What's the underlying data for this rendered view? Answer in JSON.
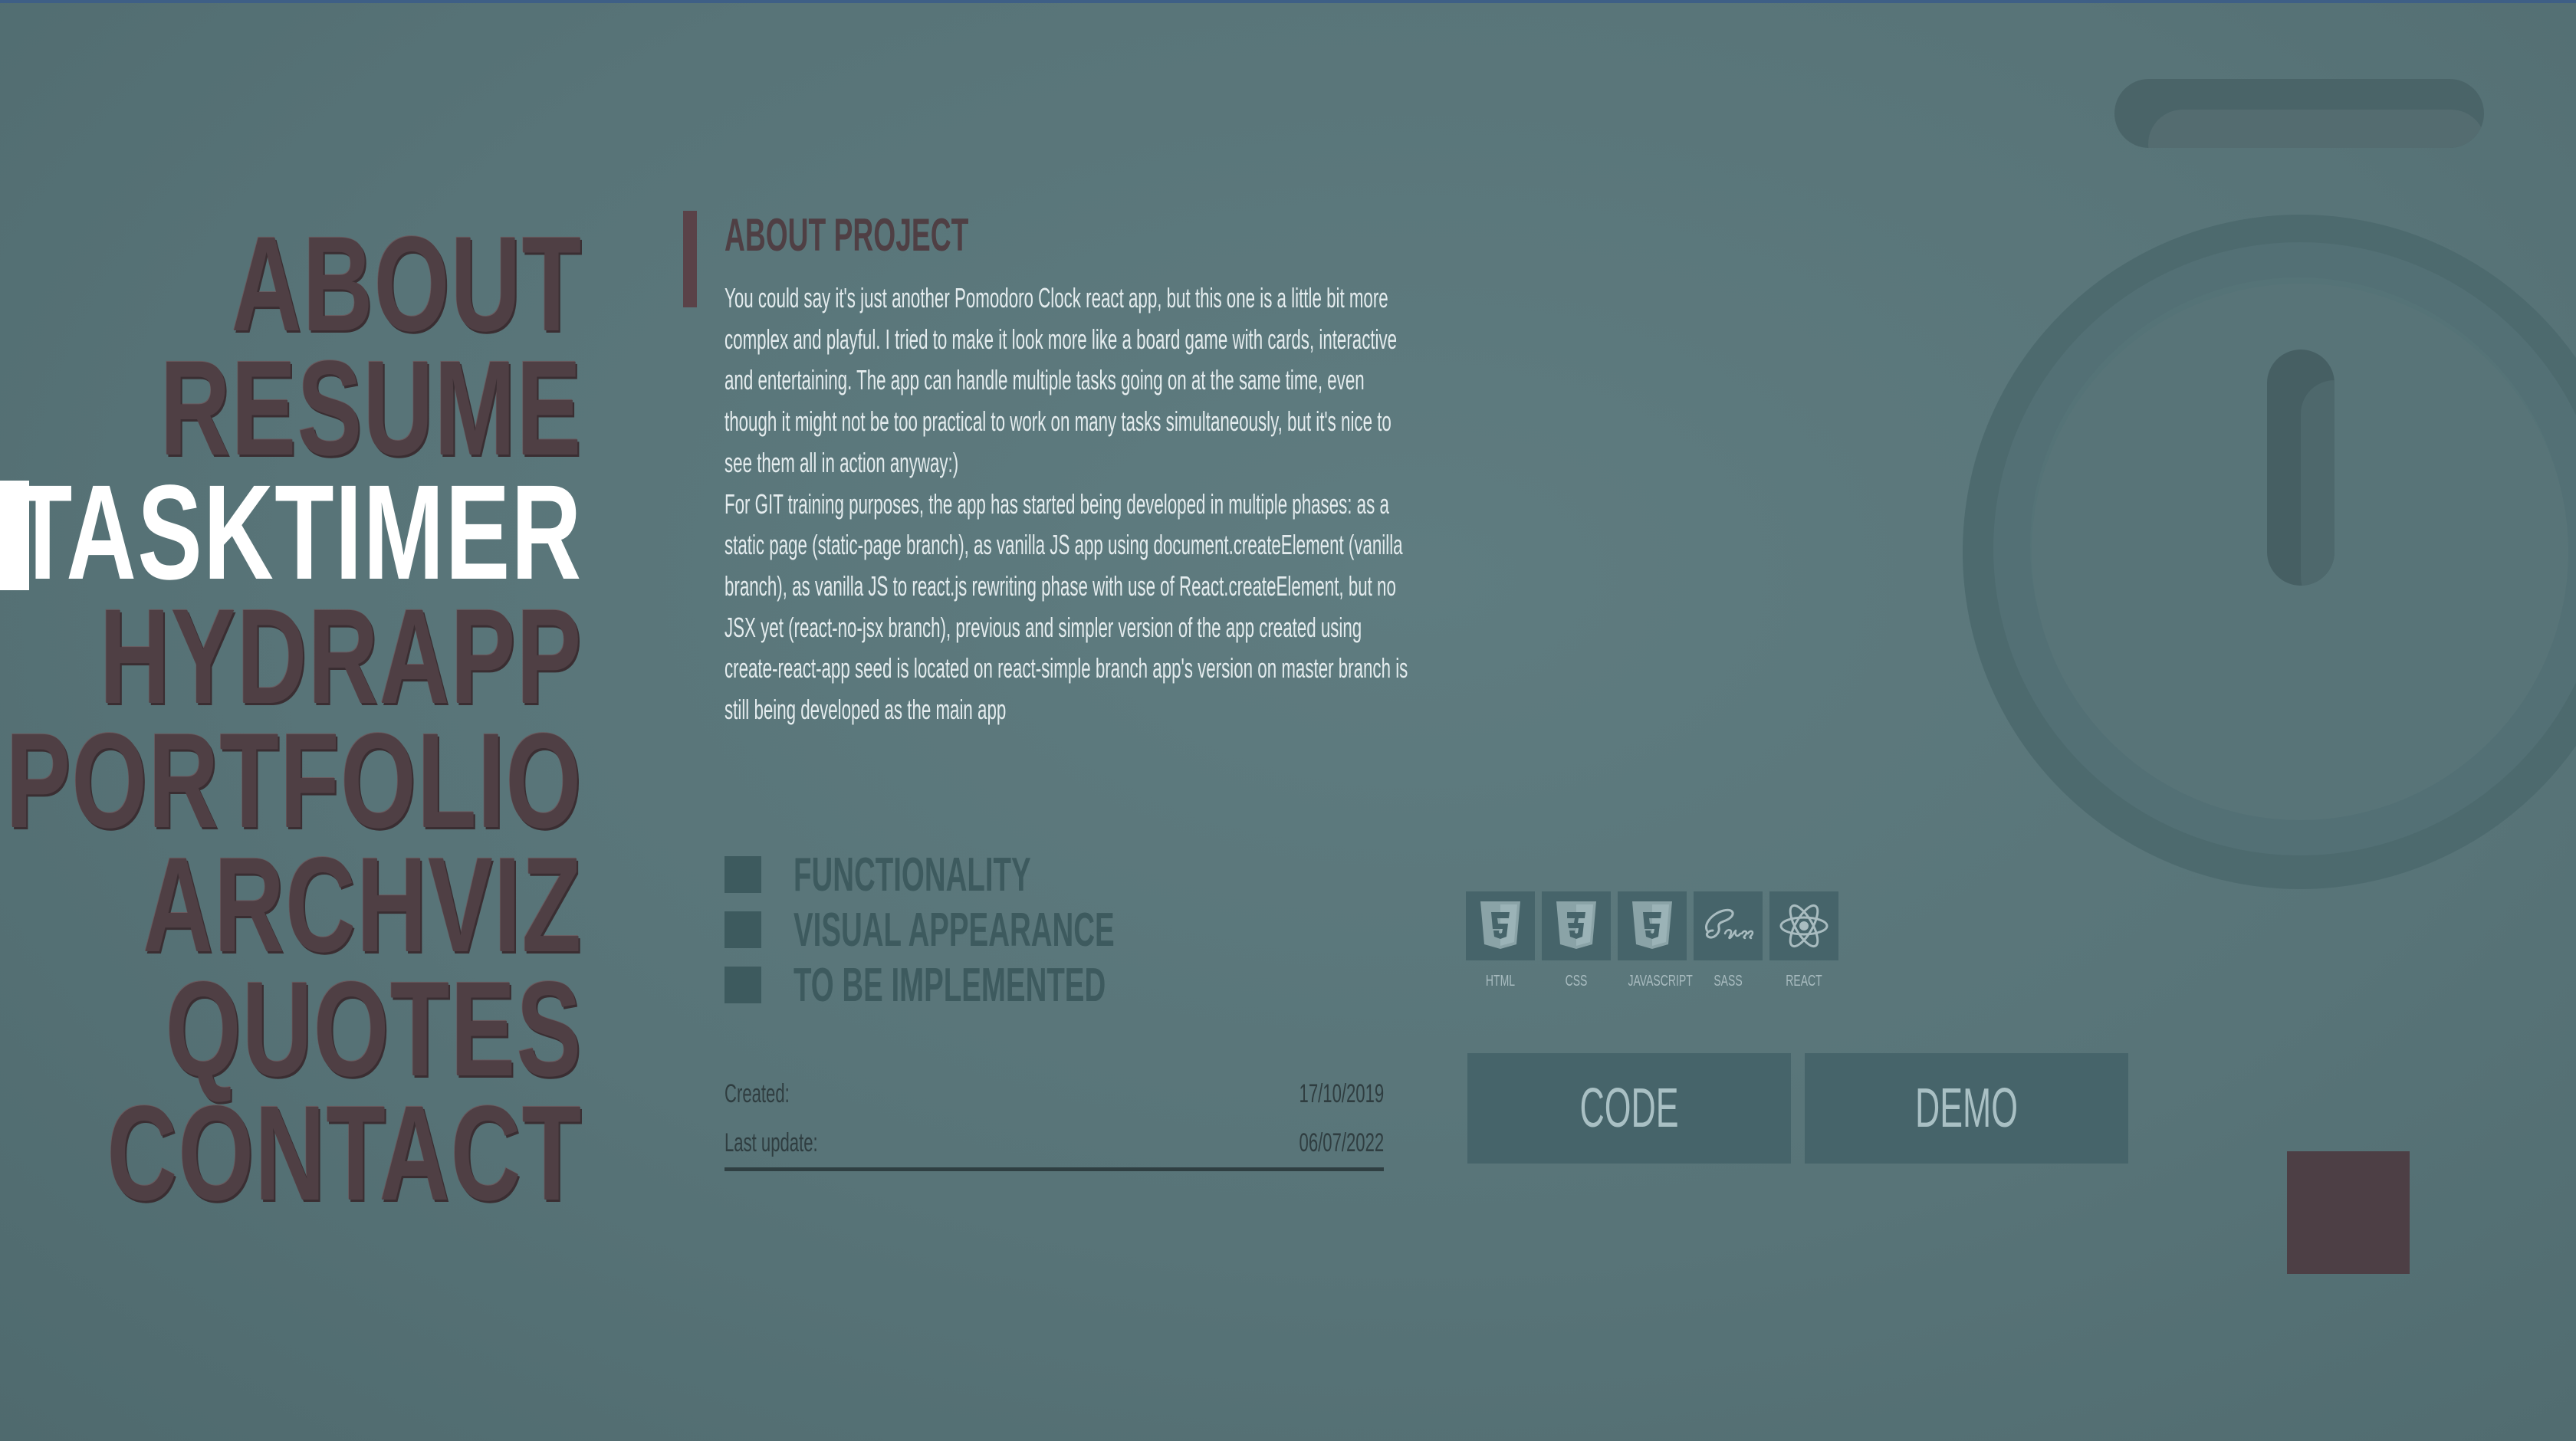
{
  "nav": {
    "items": [
      {
        "label": "ABOUT",
        "active": false
      },
      {
        "label": "RESUME",
        "active": false
      },
      {
        "label": "TASKTIMER",
        "active": true
      },
      {
        "label": "HYDRAPP",
        "active": false
      },
      {
        "label": "PORTFOLIO",
        "active": false
      },
      {
        "label": "ARCHVIZ",
        "active": false
      },
      {
        "label": "QUOTES",
        "active": false
      },
      {
        "label": "CONTACT",
        "active": false
      }
    ]
  },
  "project": {
    "title": "ABOUT PROJECT",
    "paragraph_1": "You could say it's just another Pomodoro Clock react app, but this one is a little bit more complex and playful. I tried to make it look more like a board game with cards, interactive and entertaining. The app can handle multiple tasks going on at the same time, even though it might not be too practical to work on many tasks simultaneously, but it's nice to see them all in action anyway:)",
    "paragraph_2": "For GIT training purposes, the app has started being developed in multiple phases: as a static page (static-page branch), as vanilla JS app using document.createElement (vanilla branch), as vanilla JS to react.js rewriting phase with use of React.createElement, but no JSX yet (react-no-jsx branch), previous and simpler version of the app created using create-react-app seed is located on react-simple branch app's version on master branch is still being developed as the main app",
    "legend": [
      {
        "label": "FUNCTIONALITY"
      },
      {
        "label": "VISUAL APPEARANCE"
      },
      {
        "label": "TO BE IMPLEMENTED"
      }
    ],
    "meta": {
      "created_label": "Created:",
      "created_value": "17/10/2019",
      "updated_label": "Last update:",
      "updated_value": "06/07/2022"
    }
  },
  "tech": [
    {
      "label": "HTML",
      "icon": "html5-icon"
    },
    {
      "label": "CSS",
      "icon": "css3-icon"
    },
    {
      "label": "JAVASCRIPT",
      "icon": "javascript-icon"
    },
    {
      "label": "SASS",
      "icon": "sass-icon"
    },
    {
      "label": "REACT",
      "icon": "react-icon"
    }
  ],
  "buttons": {
    "code": "CODE",
    "demo": "DEMO"
  },
  "colors": {
    "background": "#587478",
    "nav_text": "#4f3f44",
    "nav_active": "#ffffff",
    "accent": "#5a4248",
    "panel": "#46646a"
  }
}
